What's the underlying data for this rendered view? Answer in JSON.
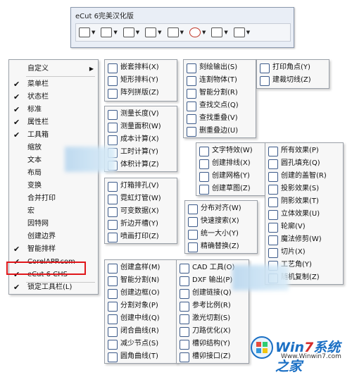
{
  "toolbar": {
    "title": "eCut 6完美汉化版",
    "icons": [
      "shapes-icon",
      "layers-icon",
      "measure-icon",
      "dimension-icon",
      "transform-icon",
      "target-icon",
      "distribute-icon",
      "panel-icon"
    ]
  },
  "main_menu": {
    "items": [
      {
        "label": "自定义",
        "checked": false,
        "submenu": true
      },
      {
        "label": "菜单栏",
        "checked": true
      },
      {
        "label": "状态栏",
        "checked": true
      },
      {
        "label": "标准",
        "checked": true
      },
      {
        "label": "属性栏",
        "checked": true
      },
      {
        "label": "工具箱",
        "checked": true
      },
      {
        "label": "缩放",
        "checked": false
      },
      {
        "label": "文本",
        "checked": false
      },
      {
        "label": "布局",
        "checked": false
      },
      {
        "label": "变换",
        "checked": false
      },
      {
        "label": "合并打印",
        "checked": false
      },
      {
        "label": "宏",
        "checked": false
      },
      {
        "label": "因特网",
        "checked": false
      },
      {
        "label": "创建边界",
        "checked": false
      },
      {
        "label": "智能排样",
        "checked": true
      },
      {
        "label": "CorelAPP.com",
        "checked": true
      },
      {
        "label": "eCut 6 CHS",
        "checked": true
      },
      {
        "label": "锁定工具栏(L)",
        "checked": true
      }
    ]
  },
  "sub_layout": [
    "嵌套排料(X)",
    "矩形排料(Y)",
    "阵列拼版(Z)"
  ],
  "sub_output": [
    "刻绘输出(S)",
    "连割物体(T)",
    "智能分割(R)",
    "查找交点(Q)",
    "查找重叠(V)",
    "删重叠边(U)"
  ],
  "sub_print": [
    "打印角点(Y)",
    "建裁切线(Z)"
  ],
  "sub_measure": [
    "测量长度(V)",
    "测量面积(W)",
    "成本计算(X)",
    "工时计算(Y)",
    "体积计算(Z)"
  ],
  "sub_text": [
    "文字特效(W)",
    "创建排线(X)",
    "创建网格(Y)",
    "创建草图(Z)"
  ],
  "sub_effects": [
    "所有效果(P)",
    "圆孔填充(Q)",
    "创建的盖智(R)",
    "投影效果(S)",
    "阴影效果(T)",
    "立体效果(U)",
    "轮廓(V)",
    "魔法修剪(W)",
    "切片(X)",
    "工艺角(Y)",
    "随机复制(Z)"
  ],
  "sub_light": [
    "灯箱排孔(V)",
    "霓虹灯管(W)",
    "可变数据(X)",
    "折边开槽(Y)",
    "喷画打印(Z)"
  ],
  "sub_align": [
    "分布对齐(W)",
    "快速搜索(X)",
    "统一大小(Y)",
    "精确替换(Z)"
  ],
  "sub_create": [
    "创建盒样(M)",
    "智能分割(N)",
    "创建边框(O)",
    "分割对象(P)",
    "创建中线(Q)",
    "闭合曲线(R)",
    "减少节点(S)",
    "圆角曲线(T)"
  ],
  "sub_cad": [
    "CAD 工具(O)",
    "DXF 输出(P)",
    "创建链接(Q)",
    "参考比例(R)",
    "激光切割(S)",
    "刀路优化(X)",
    "槽卯结构(Y)",
    "槽卯接口(Z)"
  ],
  "watermark": {
    "brand_a": "Win",
    "brand_b": "7",
    "brand_c": "系统之家",
    "url": "Www.Winwin7.com"
  }
}
